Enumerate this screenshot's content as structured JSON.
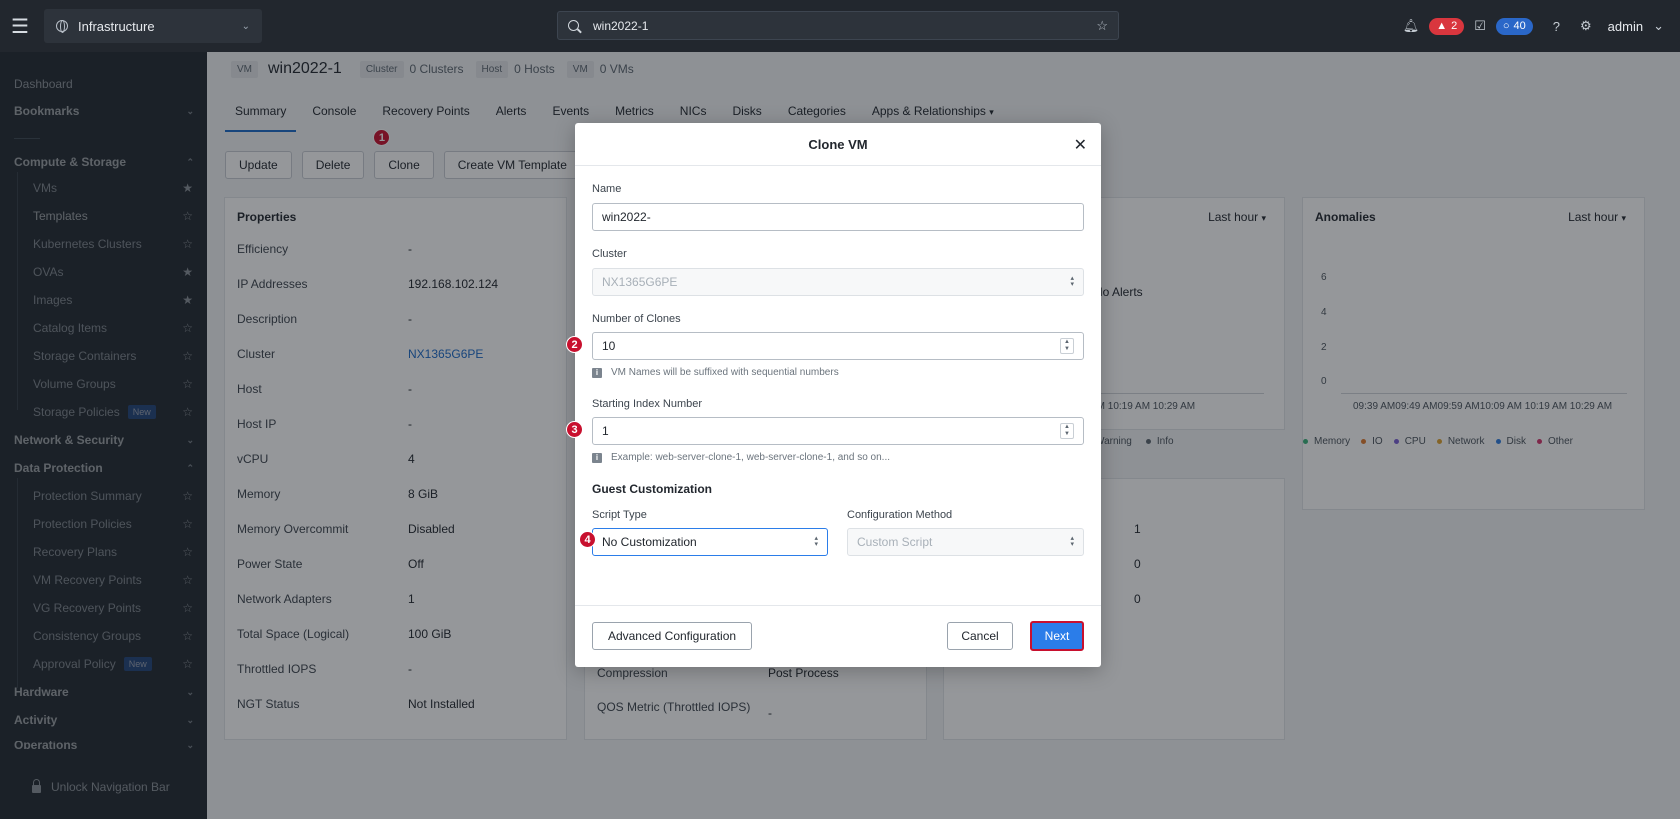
{
  "topbar": {
    "app_name": "Infrastructure",
    "search_value": "win2022-1",
    "alerts_count": "2",
    "tasks_count": "40",
    "user": "admin"
  },
  "sidebar": {
    "dashboard": "Dashboard",
    "bookmarks": "Bookmarks",
    "compute_storage": "Compute & Storage",
    "items_compute": [
      {
        "label": "VMs",
        "star": "★"
      },
      {
        "label": "Templates",
        "star": "☆"
      },
      {
        "label": "Kubernetes Clusters",
        "star": "☆"
      },
      {
        "label": "OVAs",
        "star": "★"
      },
      {
        "label": "Images",
        "star": "★"
      },
      {
        "label": "Catalog Items",
        "star": "☆"
      },
      {
        "label": "Storage Containers",
        "star": "☆"
      },
      {
        "label": "Volume Groups",
        "star": "☆"
      },
      {
        "label": "Storage Policies",
        "badge": "New",
        "star": "☆"
      }
    ],
    "network_security": "Network & Security",
    "data_protection": "Data Protection",
    "items_data": [
      {
        "label": "Protection Summary",
        "star": "☆"
      },
      {
        "label": "Protection Policies",
        "star": "☆"
      },
      {
        "label": "Recovery Plans",
        "star": "☆"
      },
      {
        "label": "VM Recovery Points",
        "star": "☆"
      },
      {
        "label": "VG Recovery Points",
        "star": "☆"
      },
      {
        "label": "Consistency Groups",
        "star": "☆"
      },
      {
        "label": "Approval Policy",
        "badge": "New",
        "star": "☆"
      }
    ],
    "hardware": "Hardware",
    "activity": "Activity",
    "operations": "Operations",
    "unlock": "Unlock Navigation Bar"
  },
  "vm_header": {
    "vm_tag": "VM",
    "name": "win2022-1",
    "cluster_tag": "Cluster",
    "clusters": "0 Clusters",
    "host_tag": "Host",
    "hosts": "0 Hosts",
    "vm_tag2": "VM",
    "vms": "0 VMs"
  },
  "tabs": [
    "Summary",
    "Console",
    "Recovery Points",
    "Alerts",
    "Events",
    "Metrics",
    "NICs",
    "Disks",
    "Categories",
    "Apps & Relationships"
  ],
  "actions": {
    "update": "Update",
    "delete": "Delete",
    "clone": "Clone",
    "create_template": "Create VM Template"
  },
  "properties": {
    "title": "Properties",
    "rows": [
      {
        "k": "Efficiency",
        "v": "-"
      },
      {
        "k": "IP Addresses",
        "v": "192.168.102.124"
      },
      {
        "k": "Description",
        "v": "-"
      },
      {
        "k": "Cluster",
        "v": "NX1365G6PE"
      },
      {
        "k": "Host",
        "v": "-"
      },
      {
        "k": "Host IP",
        "v": "-"
      },
      {
        "k": "vCPU",
        "v": "4"
      },
      {
        "k": "Memory",
        "v": "8 GiB"
      },
      {
        "k": "Memory Overcommit",
        "v": "Disabled"
      },
      {
        "k": "Power State",
        "v": "Off"
      },
      {
        "k": "Network Adapters",
        "v": "1"
      },
      {
        "k": "Total Space (Logical)",
        "v": "100 GiB"
      },
      {
        "k": "Throttled IOPS",
        "v": "-"
      },
      {
        "k": "NGT Status",
        "v": "Not Installed"
      }
    ]
  },
  "storage_card": {
    "compression_k": "Compression",
    "compression_v": "Post Process",
    "qos_k": "QOS Metric (Throttled IOPS)",
    "qos_v": "-"
  },
  "alerts_card": {
    "range": "Last hour",
    "no_alerts": "No Alerts",
    "times": "09:39 AM09:49 AM09:59 AM10:09 AM 10:19 AM 10:29 AM",
    "legend_warning": "Warning",
    "legend_info": "Info",
    "counts": [
      "1",
      "0",
      "0"
    ]
  },
  "anomalies": {
    "title": "Anomalies",
    "range": "Last hour",
    "y_ticks": [
      "6",
      "4",
      "2",
      "0"
    ],
    "times": "09:39 AM09:49 AM09:59 AM10:09 AM 10:19 AM 10:29 AM",
    "legend": [
      {
        "label": "Memory",
        "color": "#3ab27a"
      },
      {
        "label": "IO",
        "color": "#e07a2e"
      },
      {
        "label": "CPU",
        "color": "#7b5fd6"
      },
      {
        "label": "Network",
        "color": "#e0a32e"
      },
      {
        "label": "Disk",
        "color": "#2e7de0"
      },
      {
        "label": "Other",
        "color": "#d6336c"
      }
    ]
  },
  "modal": {
    "title": "Clone VM",
    "name_label": "Name",
    "name_value": "win2022-",
    "cluster_label": "Cluster",
    "cluster_value": "NX1365G6PE",
    "clones_label": "Number of Clones",
    "clones_value": "10",
    "clones_hint": "VM Names will be suffixed with sequential numbers",
    "index_label": "Starting Index Number",
    "index_value": "1",
    "index_hint": "Example: web-server-clone-1, web-server-clone-1, and so on...",
    "guest_title": "Guest Customization",
    "script_label": "Script Type",
    "script_value": "No Customization",
    "method_label": "Configuration Method",
    "method_value": "Custom Script",
    "advanced": "Advanced Configuration",
    "cancel": "Cancel",
    "next": "Next"
  },
  "markers": [
    "1",
    "2",
    "3",
    "4"
  ]
}
